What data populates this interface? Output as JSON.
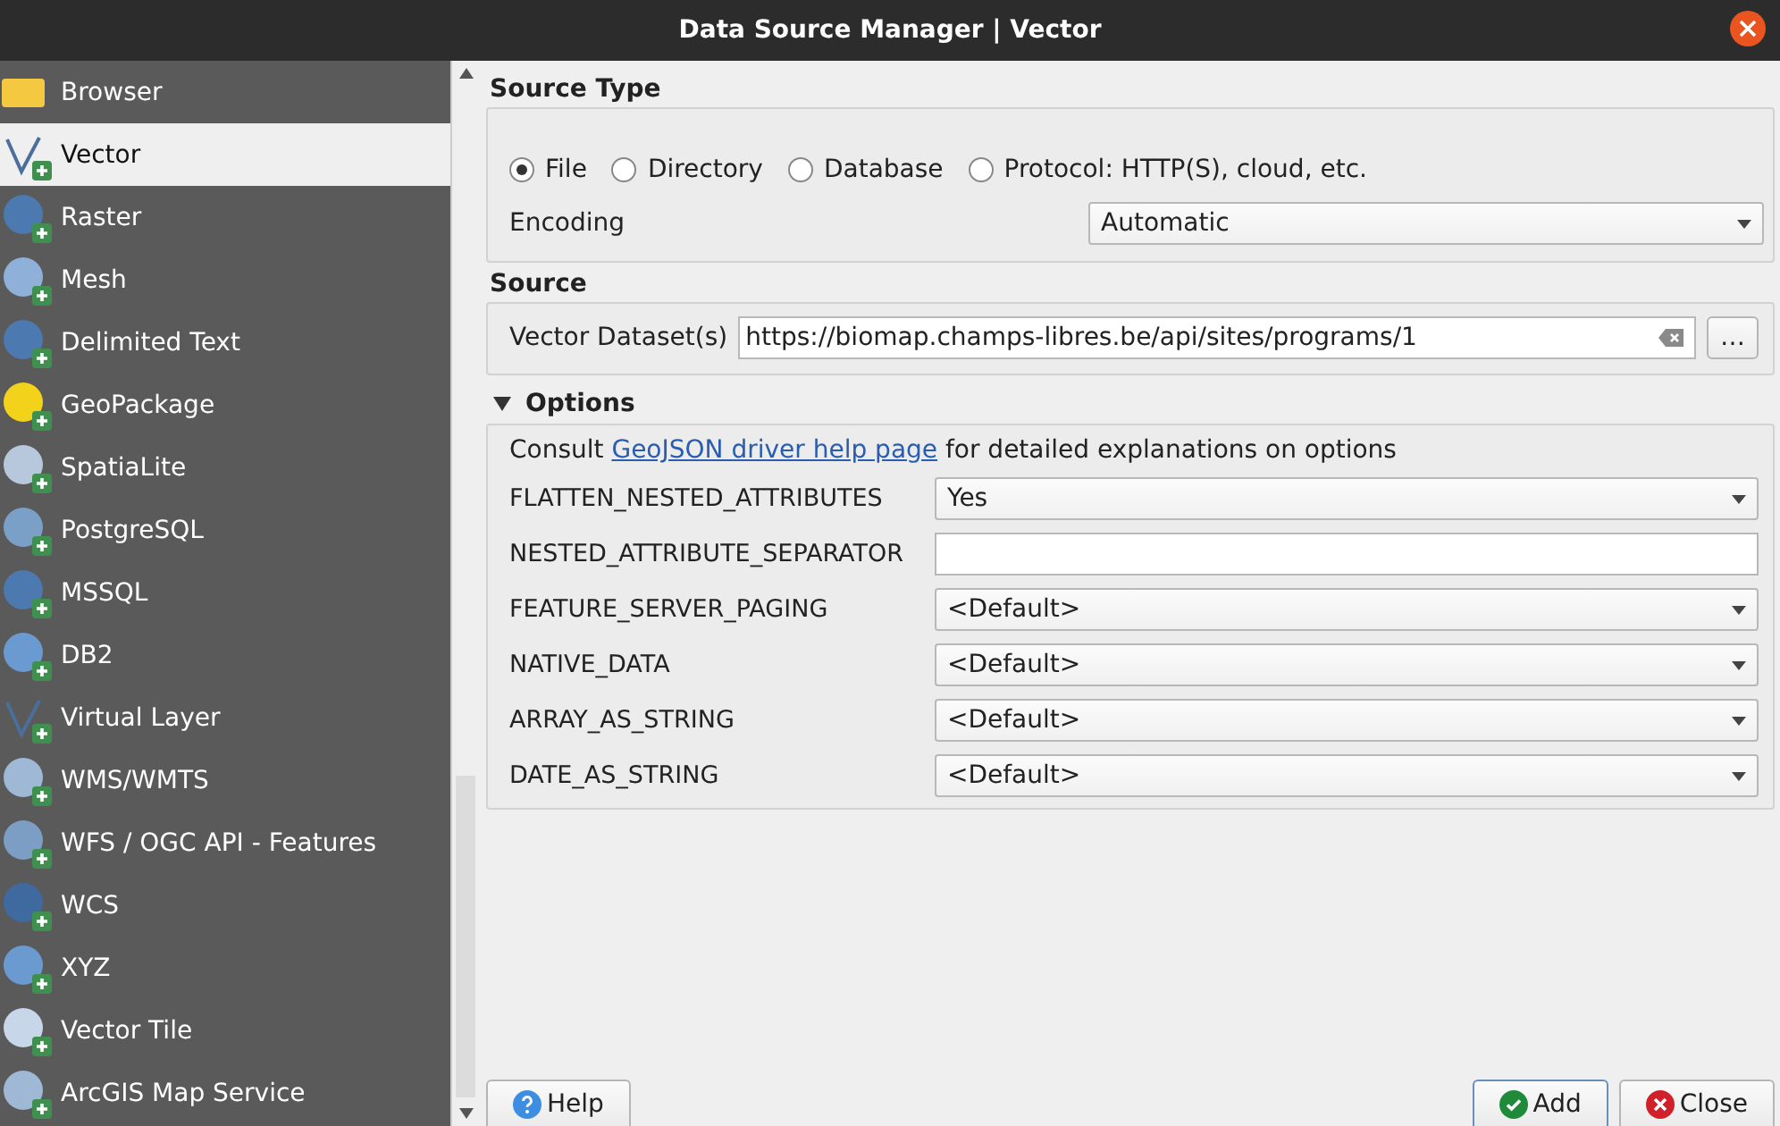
{
  "window": {
    "title": "Data Source Manager | Vector"
  },
  "sidebar": {
    "items": [
      {
        "label": "Browser",
        "selected": false
      },
      {
        "label": "Vector",
        "selected": true
      },
      {
        "label": "Raster",
        "selected": false
      },
      {
        "label": "Mesh",
        "selected": false
      },
      {
        "label": "Delimited Text",
        "selected": false
      },
      {
        "label": "GeoPackage",
        "selected": false
      },
      {
        "label": "SpatiaLite",
        "selected": false
      },
      {
        "label": "PostgreSQL",
        "selected": false
      },
      {
        "label": "MSSQL",
        "selected": false
      },
      {
        "label": "DB2",
        "selected": false
      },
      {
        "label": "Virtual Layer",
        "selected": false
      },
      {
        "label": "WMS/WMTS",
        "selected": false
      },
      {
        "label": "WFS / OGC API - Features",
        "selected": false
      },
      {
        "label": "WCS",
        "selected": false
      },
      {
        "label": "XYZ",
        "selected": false
      },
      {
        "label": "Vector Tile",
        "selected": false
      },
      {
        "label": "ArcGIS Map Service",
        "selected": false
      }
    ]
  },
  "source_type": {
    "title": "Source Type",
    "options": [
      {
        "label": "File",
        "selected": true
      },
      {
        "label": "Directory",
        "selected": false
      },
      {
        "label": "Database",
        "selected": false
      },
      {
        "label": "Protocol: HTTP(S), cloud, etc.",
        "selected": false
      }
    ],
    "encoding_label": "Encoding",
    "encoding_value": "Automatic"
  },
  "source": {
    "title": "Source",
    "dataset_label": "Vector Dataset(s)",
    "dataset_value": "https://biomap.champs-libres.be/api/sites/programs/1",
    "browse_button": "…"
  },
  "options": {
    "title": "Options",
    "expanded": true,
    "consult_before": "Consult ",
    "link": "GeoJSON driver help page",
    "consult_after": " for detailed explanations on options",
    "rows": [
      {
        "label": "FLATTEN_NESTED_ATTRIBUTES",
        "kind": "combo",
        "value": "Yes"
      },
      {
        "label": "NESTED_ATTRIBUTE_SEPARATOR",
        "kind": "text",
        "value": ""
      },
      {
        "label": "FEATURE_SERVER_PAGING",
        "kind": "combo",
        "value": "<Default>"
      },
      {
        "label": "NATIVE_DATA",
        "kind": "combo",
        "value": "<Default>"
      },
      {
        "label": "ARRAY_AS_STRING",
        "kind": "combo",
        "value": "<Default>"
      },
      {
        "label": "DATE_AS_STRING",
        "kind": "combo",
        "value": "<Default>"
      }
    ]
  },
  "buttons": {
    "help": "Help",
    "add": "Add",
    "close": "Close"
  }
}
